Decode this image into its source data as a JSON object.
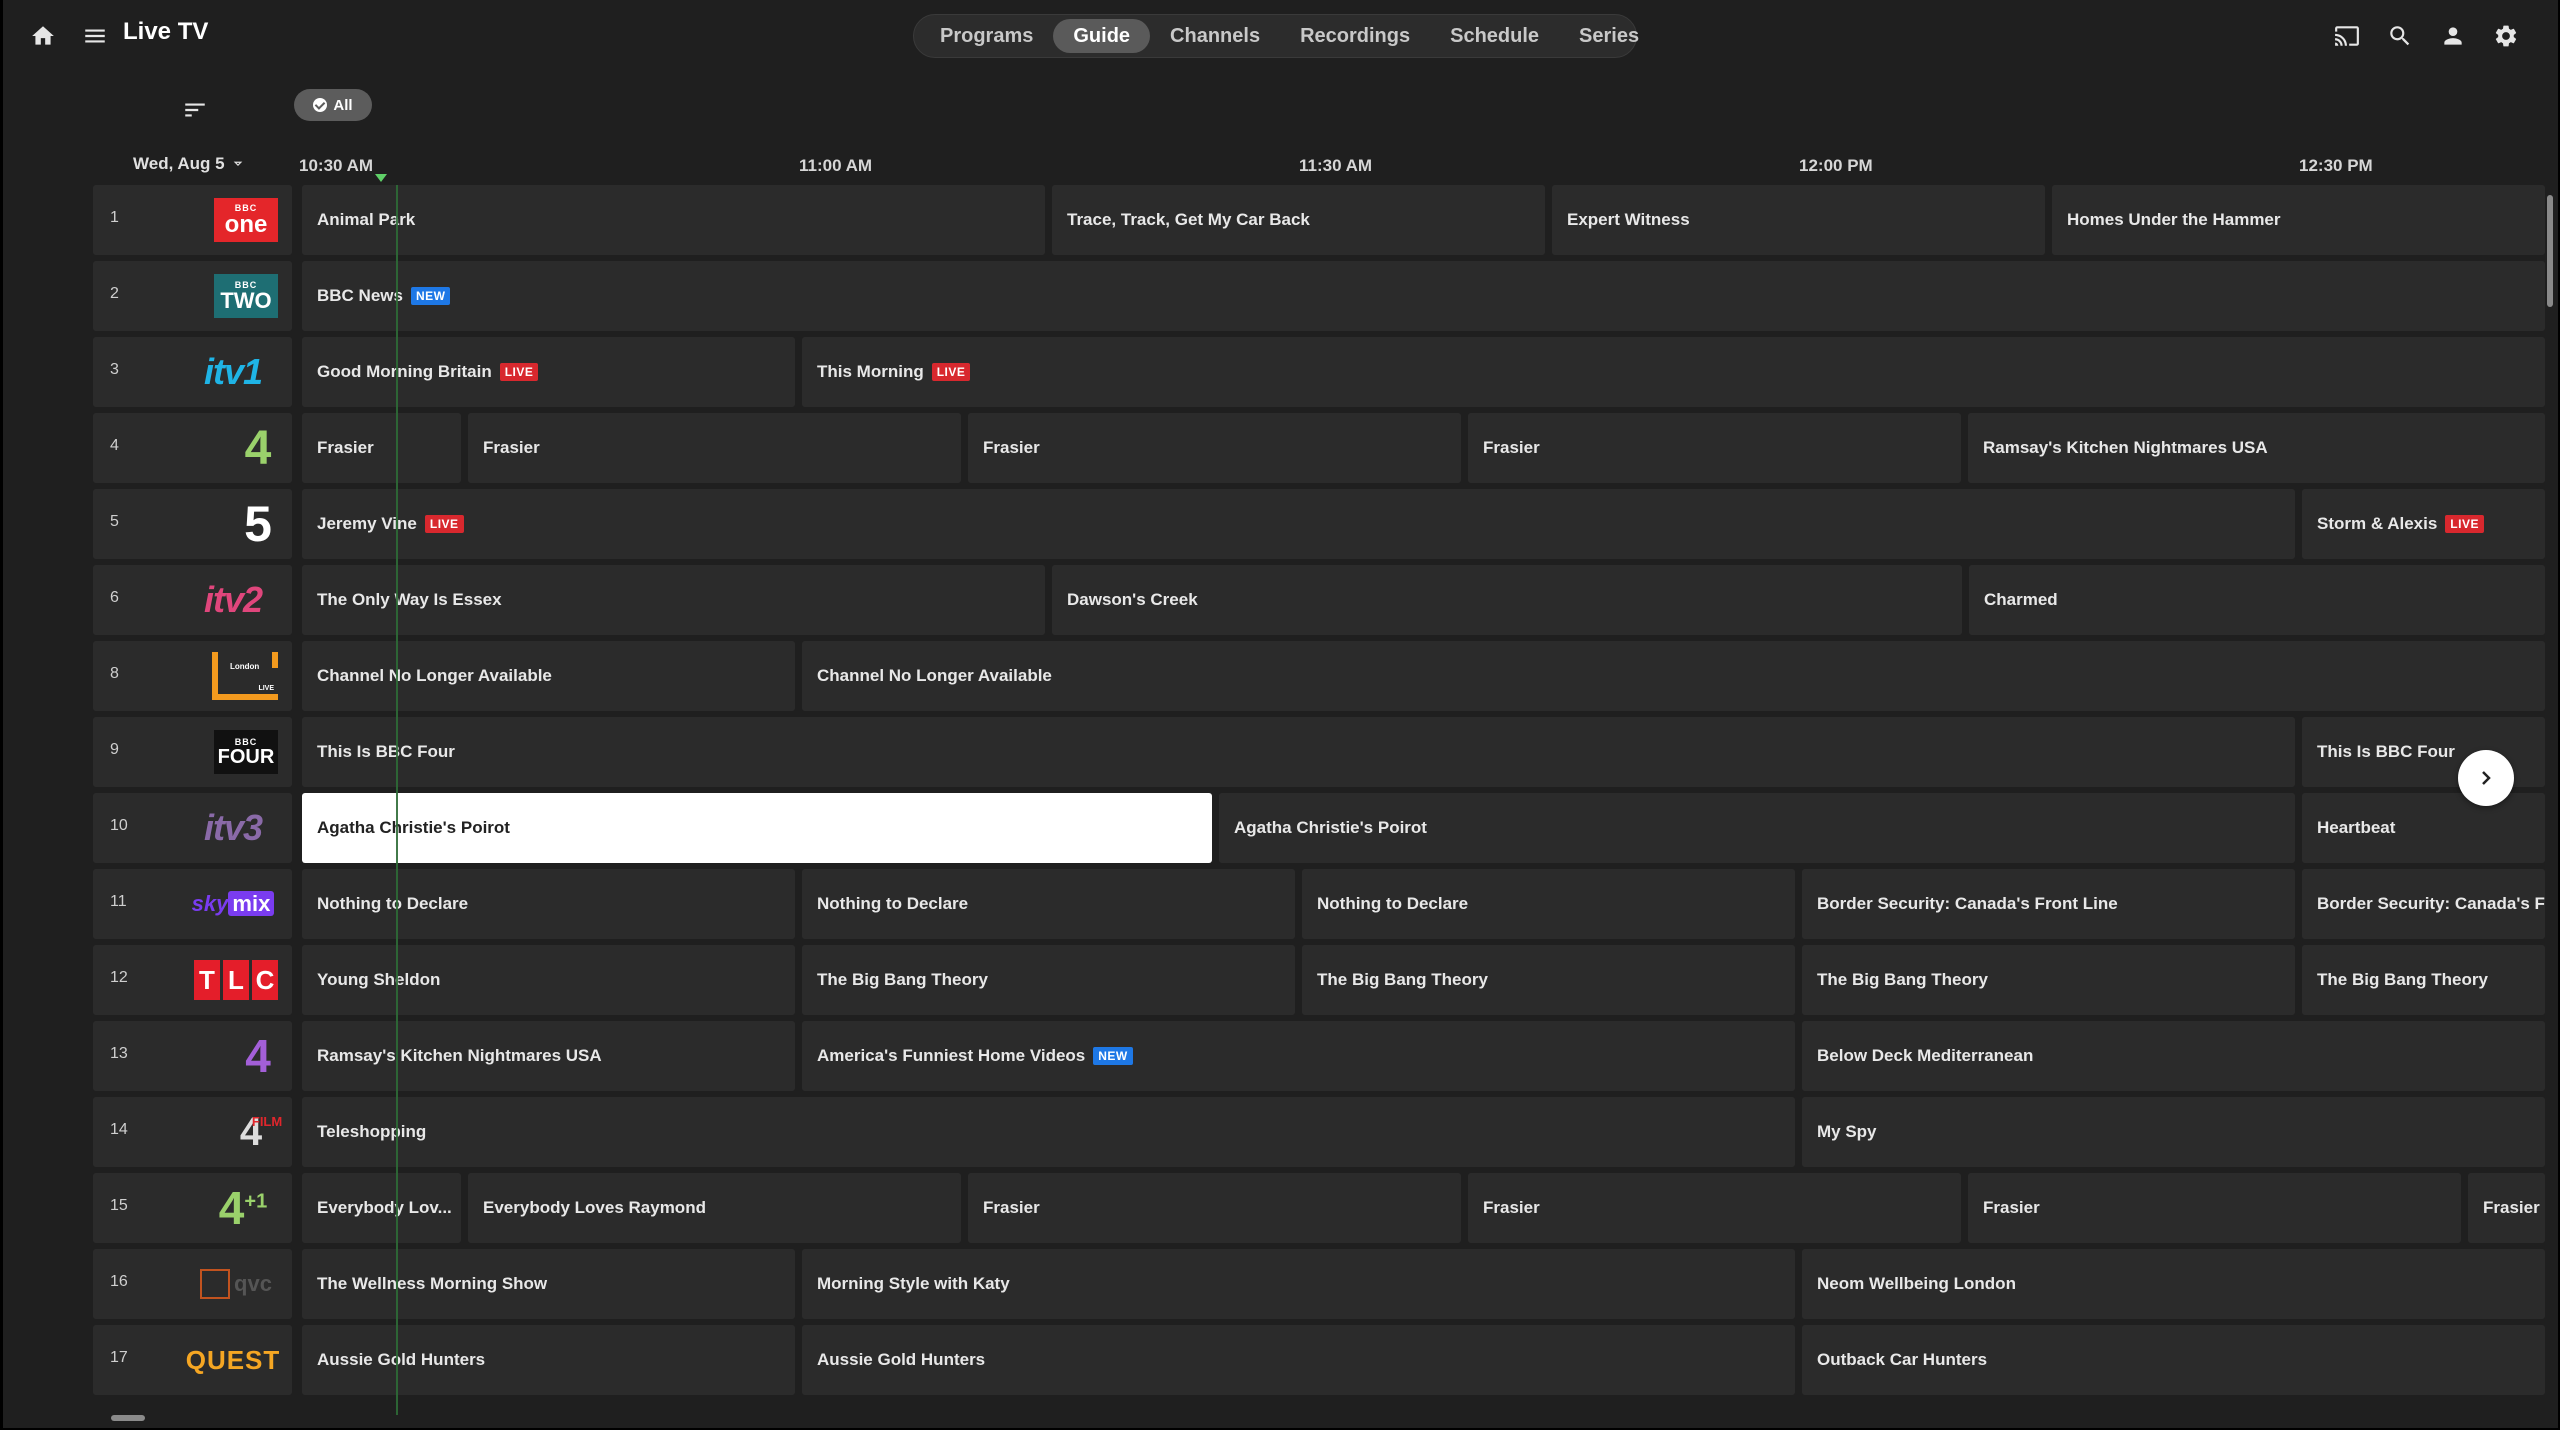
{
  "app": {
    "title": "Live TV"
  },
  "nav": {
    "tabs": [
      "Programs",
      "Guide",
      "Channels",
      "Recordings",
      "Schedule",
      "Series"
    ],
    "active": "Guide"
  },
  "filter": {
    "chip_label": "All"
  },
  "guide": {
    "date": "Wed, Aug 5",
    "times": [
      "10:30 AM",
      "11:00 AM",
      "11:30 AM",
      "12:00 PM",
      "12:30 PM"
    ],
    "channels": [
      {
        "number": "1",
        "logo": "BBC One",
        "programs": [
          {
            "title": "Animal Park",
            "badge": ""
          },
          {
            "title": "Trace, Track, Get My Car Back",
            "badge": ""
          },
          {
            "title": "Expert Witness",
            "badge": ""
          },
          {
            "title": "Homes Under the Hammer",
            "badge": ""
          }
        ]
      },
      {
        "number": "2",
        "logo": "BBC Two",
        "programs": [
          {
            "title": "BBC News",
            "badge": "NEW"
          }
        ]
      },
      {
        "number": "3",
        "logo": "ITV1",
        "programs": [
          {
            "title": "Good Morning Britain",
            "badge": "LIVE"
          },
          {
            "title": "This Morning",
            "badge": "LIVE"
          }
        ]
      },
      {
        "number": "4",
        "logo": "Channel 4",
        "programs": [
          {
            "title": "Frasier",
            "badge": ""
          },
          {
            "title": "Frasier",
            "badge": ""
          },
          {
            "title": "Frasier",
            "badge": ""
          },
          {
            "title": "Frasier",
            "badge": ""
          },
          {
            "title": "Ramsay's Kitchen Nightmares USA",
            "badge": ""
          }
        ]
      },
      {
        "number": "5",
        "logo": "Channel 5",
        "programs": [
          {
            "title": "Jeremy Vine",
            "badge": "LIVE"
          },
          {
            "title": "Storm & Alexis",
            "badge": "LIVE"
          }
        ]
      },
      {
        "number": "6",
        "logo": "ITV2",
        "programs": [
          {
            "title": "The Only Way Is Essex",
            "badge": ""
          },
          {
            "title": "Dawson's Creek",
            "badge": ""
          },
          {
            "title": "Charmed",
            "badge": ""
          }
        ]
      },
      {
        "number": "8",
        "logo": "London Live",
        "programs": [
          {
            "title": "Channel No Longer Available",
            "badge": ""
          },
          {
            "title": "Channel No Longer Available",
            "badge": ""
          }
        ]
      },
      {
        "number": "9",
        "logo": "BBC Four",
        "programs": [
          {
            "title": "This Is BBC Four",
            "badge": ""
          },
          {
            "title": "This Is BBC Four",
            "badge": ""
          }
        ]
      },
      {
        "number": "10",
        "logo": "ITV3",
        "programs": [
          {
            "title": "Agatha Christie's Poirot",
            "badge": ""
          },
          {
            "title": "Agatha Christie's Poirot",
            "badge": ""
          },
          {
            "title": "Heartbeat",
            "badge": ""
          }
        ]
      },
      {
        "number": "11",
        "logo": "Sky Mix",
        "programs": [
          {
            "title": "Nothing to Declare",
            "badge": ""
          },
          {
            "title": "Nothing to Declare",
            "badge": ""
          },
          {
            "title": "Nothing to Declare",
            "badge": ""
          },
          {
            "title": "Border Security: Canada's Front Line",
            "badge": ""
          },
          {
            "title": "Border Security: Canada's Front Line",
            "badge": ""
          }
        ]
      },
      {
        "number": "12",
        "logo": "TLC",
        "programs": [
          {
            "title": "Young Sheldon",
            "badge": ""
          },
          {
            "title": "The Big Bang Theory",
            "badge": ""
          },
          {
            "title": "The Big Bang Theory",
            "badge": ""
          },
          {
            "title": "The Big Bang Theory",
            "badge": ""
          },
          {
            "title": "The Big Bang Theory",
            "badge": ""
          }
        ]
      },
      {
        "number": "13",
        "logo": "E4",
        "programs": [
          {
            "title": "Ramsay's Kitchen Nightmares USA",
            "badge": ""
          },
          {
            "title": "America's Funniest Home Videos",
            "badge": "NEW"
          },
          {
            "title": "Below Deck Mediterranean",
            "badge": ""
          }
        ]
      },
      {
        "number": "14",
        "logo": "Film4",
        "programs": [
          {
            "title": "Teleshopping",
            "badge": ""
          },
          {
            "title": "My Spy",
            "badge": ""
          }
        ]
      },
      {
        "number": "15",
        "logo": "Channel 4 +1",
        "programs": [
          {
            "title": "Everybody Lov...",
            "badge": ""
          },
          {
            "title": "Everybody Loves Raymond",
            "badge": ""
          },
          {
            "title": "Frasier",
            "badge": ""
          },
          {
            "title": "Frasier",
            "badge": ""
          },
          {
            "title": "Frasier",
            "badge": ""
          },
          {
            "title": "Frasier",
            "badge": ""
          }
        ]
      },
      {
        "number": "16",
        "logo": "QVC",
        "programs": [
          {
            "title": "The Wellness Morning Show",
            "badge": ""
          },
          {
            "title": "Morning Style with Katy",
            "badge": ""
          },
          {
            "title": "Neom Wellbeing London",
            "badge": ""
          }
        ]
      },
      {
        "number": "17",
        "logo": "Quest",
        "programs": [
          {
            "title": "Aussie Gold Hunters",
            "badge": ""
          },
          {
            "title": "Aussie Gold Hunters",
            "badge": ""
          },
          {
            "title": "Outback Car Hunters",
            "badge": ""
          }
        ]
      }
    ]
  },
  "colors": {
    "background": "#1f1f1f",
    "cell": "#2b2b2b",
    "live": "#d8282e",
    "new": "#1e78e6",
    "now_line": "#5fd068"
  }
}
